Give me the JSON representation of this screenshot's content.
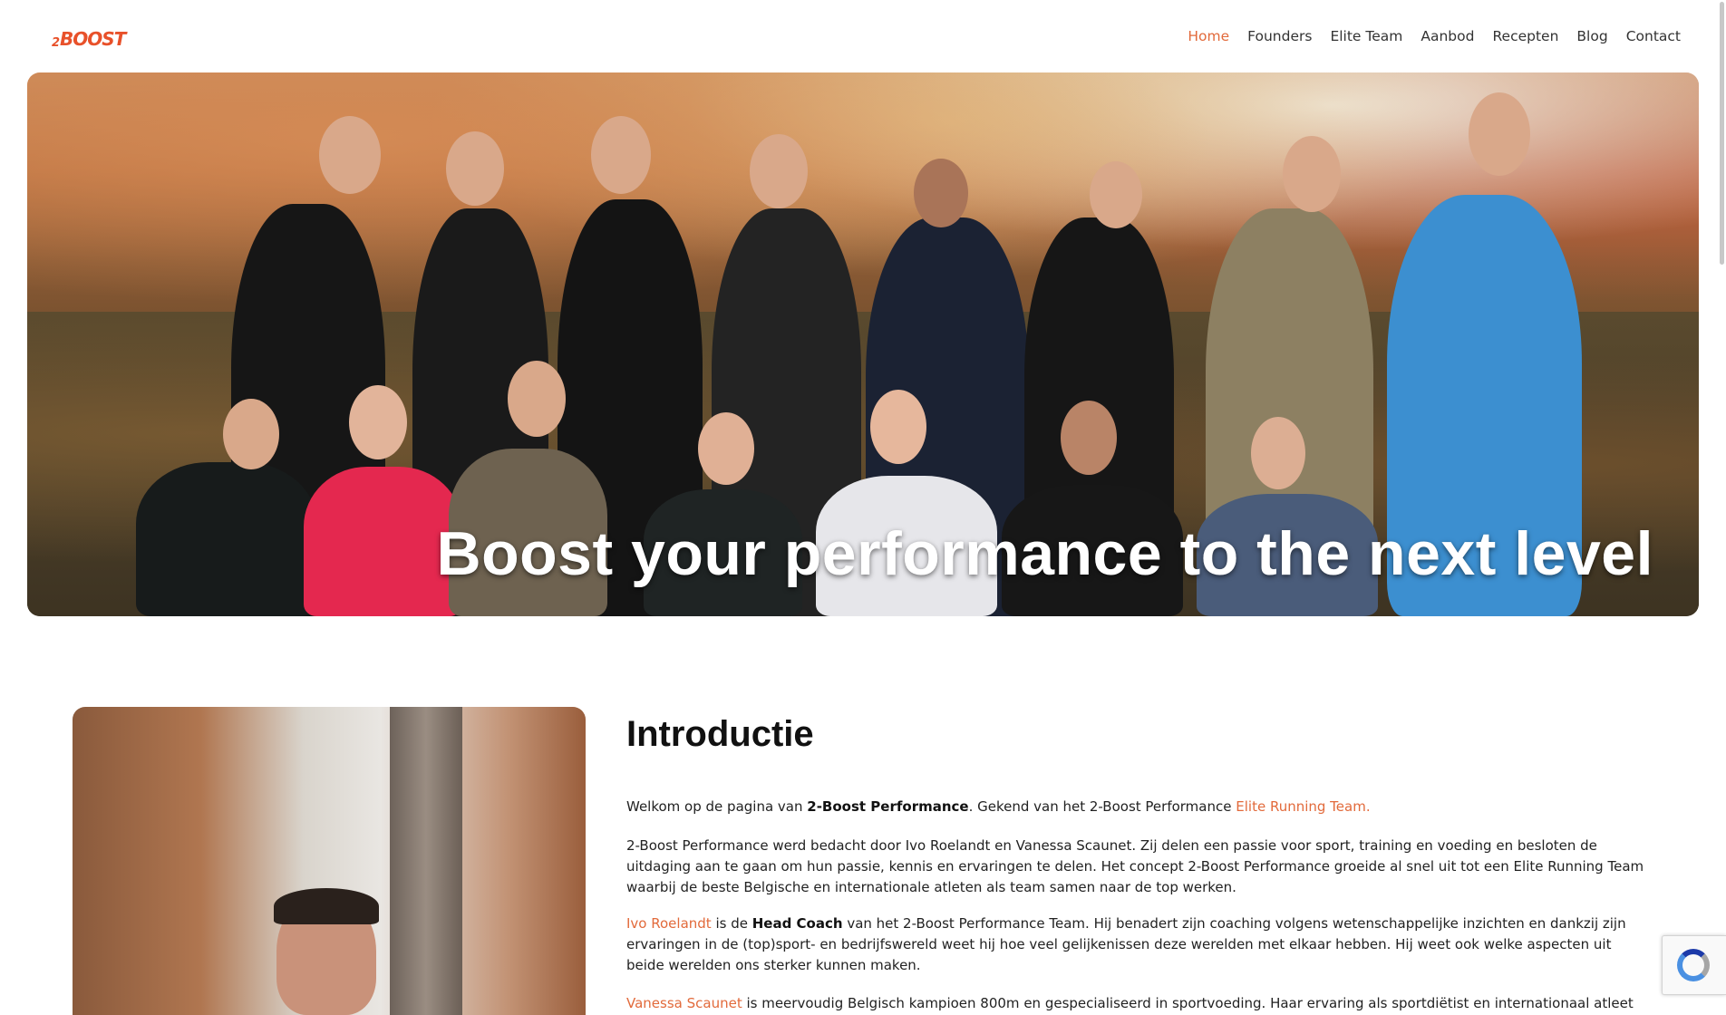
{
  "header": {
    "logo_prefix": "2",
    "logo_text": "BOOST",
    "nav": [
      {
        "label": "Home",
        "active": true
      },
      {
        "label": "Founders",
        "active": false
      },
      {
        "label": "Elite Team",
        "active": false
      },
      {
        "label": "Aanbod",
        "active": false
      },
      {
        "label": "Recepten",
        "active": false
      },
      {
        "label": "Blog",
        "active": false
      },
      {
        "label": "Contact",
        "active": false
      }
    ]
  },
  "hero": {
    "title": "Boost your performance to the next level"
  },
  "intro": {
    "heading": "Introductie",
    "p1": {
      "a": "Welkom op de pagina van ",
      "b": "2-Boost Performance",
      "c": ". Gekend van het 2-Boost Performance ",
      "link": "Elite Running Team."
    },
    "p2": "2-Boost Performance werd bedacht door Ivo Roelandt en Vanessa Scaunet. Zij delen een passie voor sport, training en voeding en besloten de uitdaging aan te gaan om hun passie, kennis en ervaringen te delen. Het concept 2-Boost Performance groeide al snel uit tot een Elite Running Team waarbij de beste Belgische en internationale atleten als team samen naar de top werken.",
    "p3": {
      "link": "Ivo Roelandt",
      "a": " is de ",
      "b": "Head Coach",
      "c": " van het 2-Boost Performance Team. Hij benadert zijn coaching volgens wetenschappelijke inzichten en dankzij zijn ervaringen in de (top)sport- en bedrijfswereld weet hij hoe veel gelijkenissen deze werelden met elkaar hebben. Hij weet ook welke aspecten uit beide werelden ons sterker kunnen maken."
    },
    "p4": {
      "link": "Vanessa Scaunet",
      "a": " is meervoudig Belgisch kampioen 800m en gespecialiseerd in sportvoeding. Haar ervaring als sportdiëtist en internationaal atleet"
    }
  },
  "colors": {
    "accent": "#e26a3b",
    "nav_text": "#333333"
  }
}
